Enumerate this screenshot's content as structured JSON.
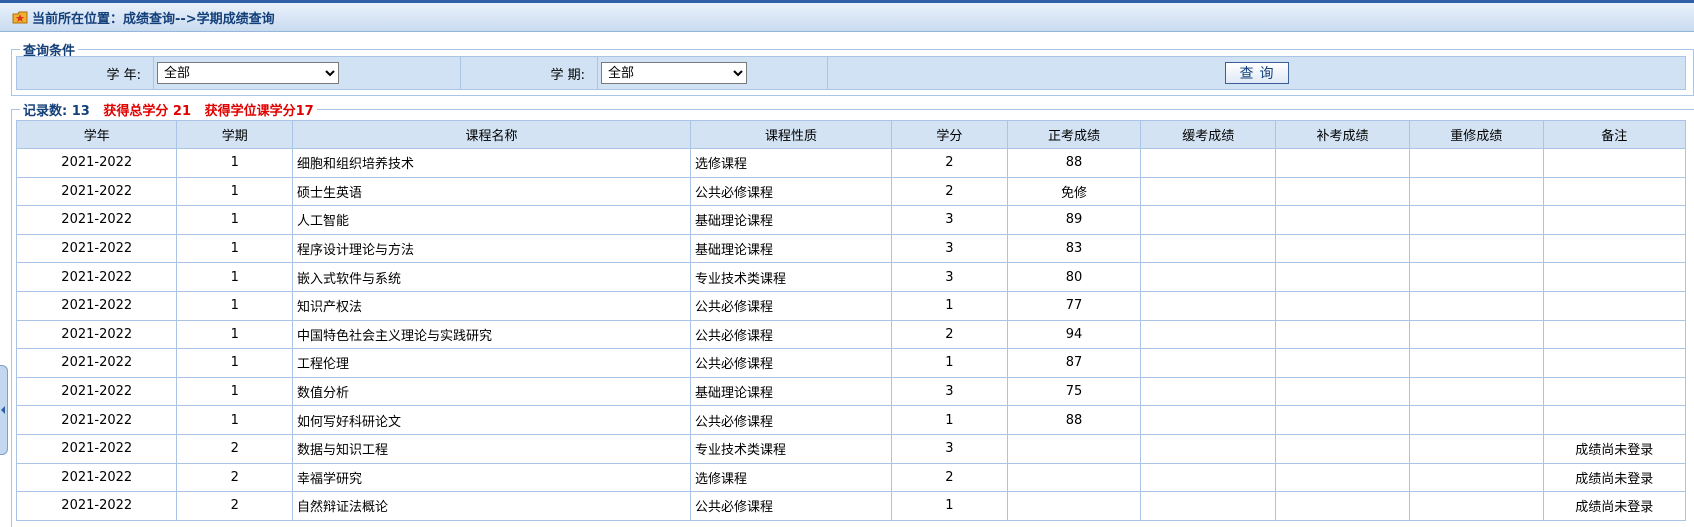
{
  "breadcrumb": {
    "text": "当前所在位置：成绩查询-->学期成绩查询"
  },
  "query": {
    "legend": "查询条件",
    "year_label": "学  年:",
    "year_value": "全部",
    "term_label": "学  期:",
    "term_value": "全部",
    "button_label": "查询"
  },
  "summary": {
    "record_label": "记录数: 13",
    "total_credits": "获得总学分 21",
    "degree_credits": "获得学位课学分17"
  },
  "table": {
    "headers": [
      "学年",
      "学期",
      "课程名称",
      "课程性质",
      "学分",
      "正考成绩",
      "缓考成绩",
      "补考成绩",
      "重修成绩",
      "备注"
    ],
    "rows": [
      [
        "2021-2022",
        "1",
        "细胞和组织培养技术",
        "选修课程",
        "2",
        "88",
        "",
        "",
        "",
        ""
      ],
      [
        "2021-2022",
        "1",
        "硕士生英语",
        "公共必修课程",
        "2",
        "免修",
        "",
        "",
        "",
        ""
      ],
      [
        "2021-2022",
        "1",
        "人工智能",
        "基础理论课程",
        "3",
        "89",
        "",
        "",
        "",
        ""
      ],
      [
        "2021-2022",
        "1",
        "程序设计理论与方法",
        "基础理论课程",
        "3",
        "83",
        "",
        "",
        "",
        ""
      ],
      [
        "2021-2022",
        "1",
        "嵌入式软件与系统",
        "专业技术类课程",
        "3",
        "80",
        "",
        "",
        "",
        ""
      ],
      [
        "2021-2022",
        "1",
        "知识产权法",
        "公共必修课程",
        "1",
        "77",
        "",
        "",
        "",
        ""
      ],
      [
        "2021-2022",
        "1",
        "中国特色社会主义理论与实践研究",
        "公共必修课程",
        "2",
        "94",
        "",
        "",
        "",
        ""
      ],
      [
        "2021-2022",
        "1",
        "工程伦理",
        "公共必修课程",
        "1",
        "87",
        "",
        "",
        "",
        ""
      ],
      [
        "2021-2022",
        "1",
        "数值分析",
        "基础理论课程",
        "3",
        "75",
        "",
        "",
        "",
        ""
      ],
      [
        "2021-2022",
        "1",
        "如何写好科研论文",
        "公共必修课程",
        "1",
        "88",
        "",
        "",
        "",
        ""
      ],
      [
        "2021-2022",
        "2",
        "数据与知识工程",
        "专业技术类课程",
        "3",
        "",
        "",
        "",
        "",
        "成绩尚未登录"
      ],
      [
        "2021-2022",
        "2",
        "幸福学研究",
        "选修课程",
        "2",
        "",
        "",
        "",
        "",
        "成绩尚未登录"
      ],
      [
        "2021-2022",
        "2",
        "自然辩证法概论",
        "公共必修课程",
        "1",
        "",
        "",
        "",
        "",
        "成绩尚未登录"
      ]
    ]
  },
  "icons": {
    "crumb": "star-folder-icon",
    "sidetab": "collapse-arrow-icon"
  },
  "colors": {
    "accent": "#14407a",
    "highlight": "#e00000",
    "header_bg": "#d3e3f4"
  }
}
